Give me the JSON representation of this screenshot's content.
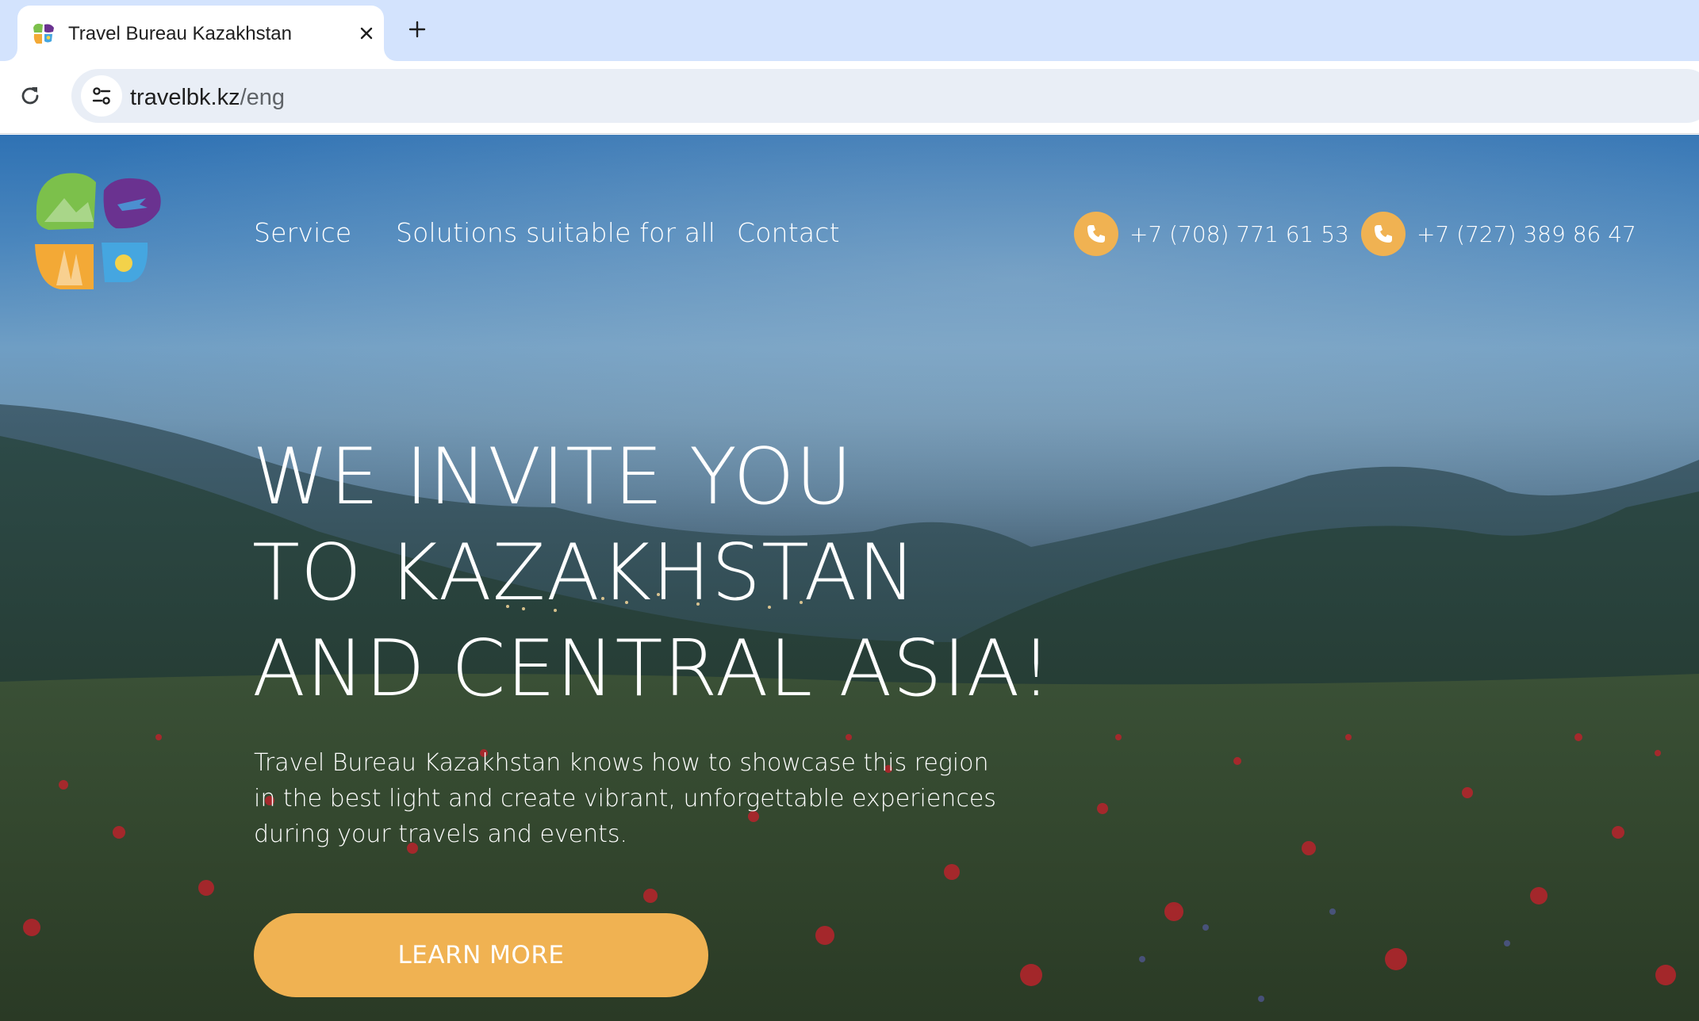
{
  "browser": {
    "tab": {
      "title": "Travel Bureau Kazakhstan"
    },
    "address_bar": {
      "host": "travelbk.kz",
      "path": "/eng"
    }
  },
  "site": {
    "nav": {
      "service": "Service",
      "solutions": "Solutions suitable for all",
      "contact": "Contact"
    },
    "phones": [
      "+7 (708) 771 61 53",
      "+7 (727) 389 86 47"
    ],
    "hero": {
      "headline": [
        "WE INVITE YOU",
        "TO KAZAKHSTAN",
        "AND CENTRAL ASIA!"
      ],
      "lead": [
        "Travel Bureau Kazakhstan knows how to showcase this region",
        "in the best light and create vibrant, unforgettable experiences",
        "during your travels and events."
      ],
      "cta": "LEARN MORE"
    }
  },
  "icons": {
    "tab_favicon": "travel-bureau-logo",
    "tab_close": "close-icon",
    "new_tab": "plus-icon",
    "reload": "reload-icon",
    "site_info": "tune-icon",
    "phone": "phone-icon"
  },
  "colors": {
    "tabstrip": "#d3e3fd",
    "omnibox": "#e9eef6",
    "accent": "#f0b252",
    "text_on_hero": "#ffffff",
    "logo_green": "#7cc04b",
    "logo_purple": "#6a3290",
    "logo_orange": "#f3a936",
    "logo_blue": "#45a6e0"
  }
}
